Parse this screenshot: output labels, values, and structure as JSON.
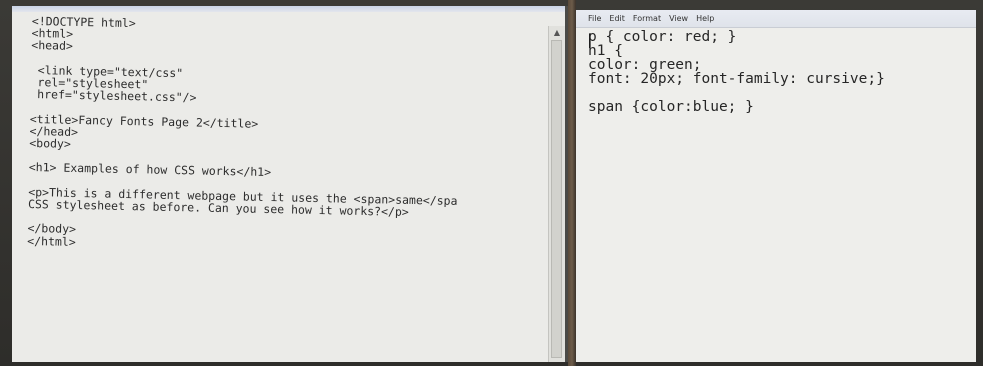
{
  "left_editor": {
    "code": "<!DOCTYPE html>\n<html>\n<head>\n\n <link type=\"text/css\"\n rel=\"stylesheet\"\n href=\"stylesheet.css\"/>\n\n<title>Fancy Fonts Page 2</title>\n</head>\n<body>\n\n<h1> Examples of how CSS works</h1>\n\n<p>This is a different webpage but it uses the <span>same</spa\nCSS stylesheet as before. Can you see how it works?</p>\n\n</body>\n</html>",
    "scroll_up_icon": "▲"
  },
  "right_editor": {
    "menu": [
      "File",
      "Edit",
      "Format",
      "View",
      "Help"
    ],
    "code": "p { color: red; }\nh1 {\ncolor: green;\nfont: 20px; font-family: cursive;}\n\nspan {color:blue; }"
  }
}
